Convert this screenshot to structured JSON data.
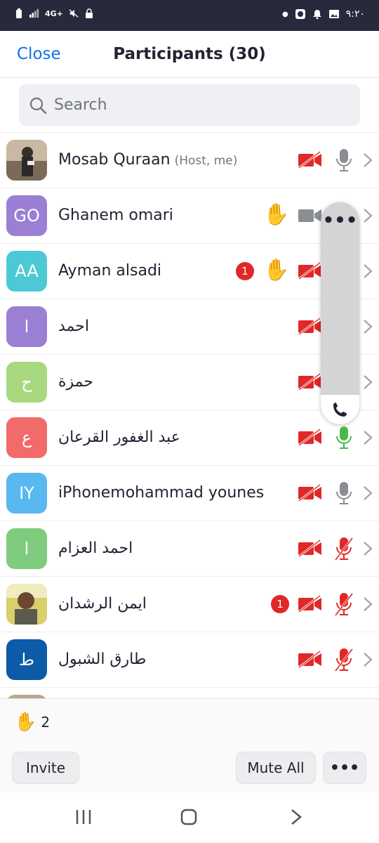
{
  "status_bar": {
    "network": "4G+",
    "time": "٩:٢٠"
  },
  "header": {
    "close_label": "Close",
    "title": "Participants (30)"
  },
  "search": {
    "placeholder": "Search"
  },
  "participants": [
    {
      "name": "Mosab Quraan",
      "tag": "(Host, me)",
      "avatar_type": "photo",
      "avatar_text": "",
      "avatar_color": "#8a7a6a",
      "hand": false,
      "badge": "",
      "video": "off",
      "mic": "on-idle"
    },
    {
      "name": "Ghanem omari",
      "tag": "",
      "avatar_type": "initials",
      "avatar_text": "GO",
      "avatar_color": "#9b7fd4",
      "hand": true,
      "badge": "",
      "video": "on",
      "mic": "hidden"
    },
    {
      "name": "Ayman alsadi",
      "tag": "",
      "avatar_type": "initials",
      "avatar_text": "AA",
      "avatar_color": "#4dc9d6",
      "hand": true,
      "badge": "1",
      "video": "off",
      "mic": "hidden"
    },
    {
      "name": "احمد",
      "tag": "",
      "avatar_type": "initials",
      "avatar_text": "ا",
      "avatar_color": "#9b7fd4",
      "hand": false,
      "badge": "",
      "video": "off",
      "mic": "hidden"
    },
    {
      "name": "حمزة",
      "tag": "",
      "avatar_type": "initials",
      "avatar_text": "ح",
      "avatar_color": "#a8d87f",
      "hand": false,
      "badge": "",
      "video": "off",
      "mic": "hidden"
    },
    {
      "name": "عبد الغفور القرعان",
      "tag": "",
      "avatar_type": "initials",
      "avatar_text": "ع",
      "avatar_color": "#f26b6b",
      "hand": false,
      "badge": "",
      "video": "off",
      "mic": "speaking"
    },
    {
      "name": "iPhonemohammad younes",
      "tag": "",
      "avatar_type": "initials",
      "avatar_text": "IY",
      "avatar_color": "#5ab8f0",
      "hand": false,
      "badge": "",
      "video": "off",
      "mic": "on-idle"
    },
    {
      "name": "احمد العزام",
      "tag": "",
      "avatar_type": "initials",
      "avatar_text": "ا",
      "avatar_color": "#7fcc7f",
      "hand": false,
      "badge": "",
      "video": "off",
      "mic": "muted"
    },
    {
      "name": "ايمن الرشدان",
      "tag": "",
      "avatar_type": "photo2",
      "avatar_text": "",
      "avatar_color": "#c9c46a",
      "hand": false,
      "badge": "1",
      "video": "off",
      "mic": "muted"
    },
    {
      "name": "طارق الشبول",
      "tag": "",
      "avatar_type": "initials",
      "avatar_text": "ط",
      "avatar_color": "#0d5aa7",
      "hand": false,
      "badge": "",
      "video": "off",
      "mic": "muted"
    }
  ],
  "overlay": {
    "more_label": "•••"
  },
  "footer": {
    "raised_hand_count": "2",
    "invite_label": "Invite",
    "mute_all_label": "Mute All",
    "more_label": "•••"
  },
  "colors": {
    "accent": "#0e72ed",
    "muted_red": "#e02828",
    "speaking_green": "#4cb84c",
    "idle_gray": "#8a8d92"
  }
}
